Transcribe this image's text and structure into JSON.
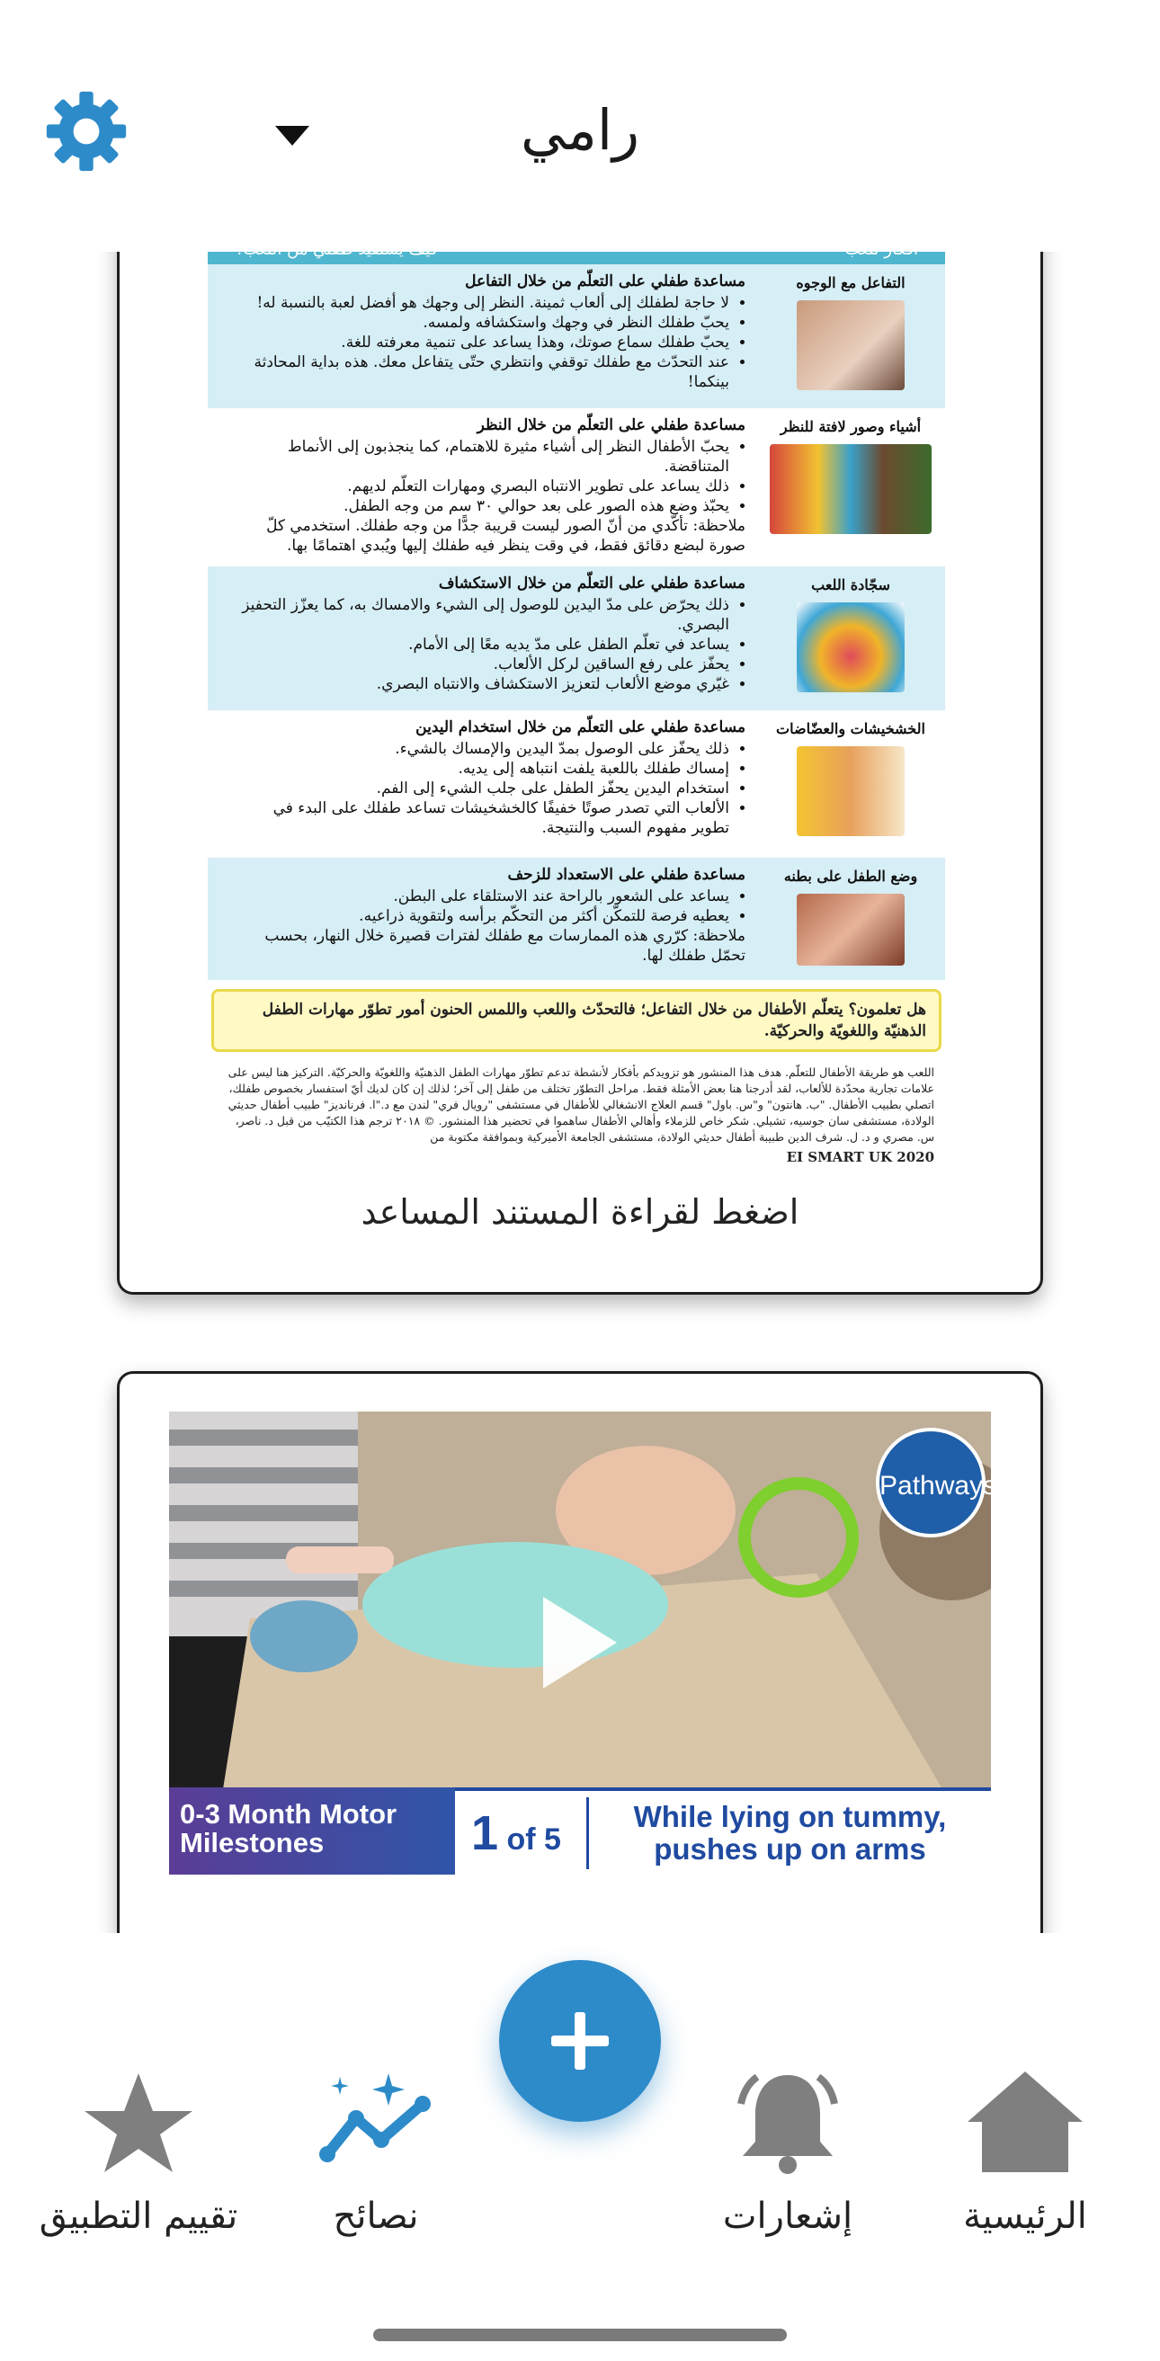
{
  "header": {
    "title": "رامي",
    "settings_icon": "gear-icon",
    "dropdown_icon": "caret-down-icon"
  },
  "doc_card": {
    "page": {
      "header_left": "كيف يستفيد طفلي من اللعب؟",
      "header_right": "أفكار للعب",
      "rows": [
        {
          "label": "التفاعل مع الوجوه",
          "title": "مساعدة طفلي على التعلّم من خلال التفاعل",
          "bullets": [
            "لا حاجة لطفلك إلى ألعاب ثمينة. النظر إلى وجهك هو أفضل لعبة بالنسبة له!",
            "يحبّ طفلك النظر في وجهك واستكشافه ولمسه.",
            "يحبّ طفلك سماع صوتك، وهذا يساعد على تنمية معرفته للغة.",
            "عند التحدّث مع طفلك توقفي وانتظري حتّى يتفاعل معك. هذه بداية المحادثة بينكما!"
          ]
        },
        {
          "label": "أشياء وصور لافتة للنظر",
          "title": "مساعدة طفلي على التعلّم من خلال النظر",
          "bullets": [
            "يحبّ الأطفال النظر إلى أشياء مثيرة للاهتمام، كما ينجذبون إلى الأنماط المتناقضة.",
            "ذلك يساعد على تطوير الانتباه البصري ومهارات التعلّم لديهم.",
            "يحبّذ وضع هذه الصور على بعد حوالي ٣٠ سم من وجه الطفل."
          ],
          "note": "ملاحظة: تأكّدي من أنّ الصور ليست قريبة جدًّا من وجه طفلك. استخدمي كلّ صورة لبضع دقائق فقط، في وقت ينظر فيه طفلك إليها ويُبدي اهتمامًا بها."
        },
        {
          "label": "سجّادة اللعب",
          "title": "مساعدة طفلي على التعلّم من خلال الاستكشاف",
          "bullets": [
            "ذلك يحرّض على مدّ اليدين للوصول إلى الشيء والامساك به، كما يعزّز التحفيز البصري.",
            "يساعد في تعلّم الطفل على مدّ يديه معًا إلى الأمام.",
            "يحفّز على رفع الساقين لركل الألعاب.",
            "غيّري موضع الألعاب لتعزيز الاستكشاف والانتباه البصري."
          ]
        },
        {
          "label": "الخشخيشات والعضّاضات",
          "title": "مساعدة طفلي على التعلّم من خلال استخدام اليدين",
          "bullets": [
            "ذلك يحفّز على الوصول بمدّ اليدين والإمساك بالشيء.",
            "إمساك طفلك باللعبة يلفت انتباهه إلى يديه.",
            "استخدام اليدين يحفّز الطفل على جلب الشيء إلى الفم.",
            "الألعاب التي تصدر صوتًا خفيفًا كالخشخيشات تساعد طفلك على البدء في تطوير مفهوم السبب والنتيجة."
          ]
        },
        {
          "label": "وضع الطفل على بطنه",
          "title": "مساعدة طفلي على الاستعداد للزحف",
          "bullets": [
            "يساعد على الشعور بالراحة عند الاستلقاء على البطن.",
            "يعطيه فرصة للتمكّن أكثر من التحكّم برأسه ولتقوية ذراعيه."
          ],
          "note": "ملاحظة: كرّري هذه الممارسات مع طفلك لفترات قصيرة خلال النهار، بحسب تحمّل طفلك لها."
        }
      ],
      "highlight": "هل تعلمون؟ يتعلّم الأطفال من خلال التفاعل؛ فالتحدّث واللعب واللمس الحنون أمور تطوّر مهارات الطفل الذهنيّة واللغويّة والحركيّة.",
      "footer": "اللعب هو طريقة الأطفال للتعلّم. هدف هذا المنشور هو تزويدكم بأفكار لأنشطة تدعم تطوّر مهارات الطفل الذهنيّة واللغويّة والحركيّة. التركيز هنا ليس على علامات تجارية محدّدة للألعاب، لقد أدرجنا هنا بعض الأمثلة فقط. مراحل التطوّر تختلف من طفل إلى آخر؛ لذلك إن كان لديك أيّ استفسار بخصوص طفلك، اتصلي بطبيب الأطفال. \"ب. هانتون\" و\"س. باول\" قسم العلاج الانشغالي للأطفال في مستشفى \"رويال فري\" لندن مع د.\"ا. فرنانديز\" طبيب أطفال حديثي الولادة، مستشفى سان جوسيه، تشيلي. شكر خاص للزملاء وأهالي الأطفال ساهموا في تحضير هذا المنشور. © ٢٠١٨ ترجم هذا الكتيّب من قبل د. ناصر، س. مصري و د. ل. شرف الدين طبيبة أطفال حديثي الولادة، مستشفى الجامعة الأميركية وبموافقة مكتوبة من",
      "signature": "EI SMART UK 2020"
    },
    "caption": "اضغط لقراءة المستند المساعد"
  },
  "video_card": {
    "badge": "Pathways",
    "banner_left": "0-3 Month Motor Milestones",
    "banner_count_num": "1",
    "banner_count_rest": "of 5",
    "banner_text": "While lying on tummy, pushes up on arms",
    "play_icon": "play-icon"
  },
  "fab": {
    "icon": "plus-icon"
  },
  "nav": [
    {
      "label": "الرئيسية",
      "icon": "home-icon"
    },
    {
      "label": "إشعارات",
      "icon": "bell-icon"
    },
    {
      "label": "نصائح",
      "icon": "trend-sparkle-icon"
    },
    {
      "label": "تقييم التطبيق",
      "icon": "star-icon"
    }
  ],
  "colors": {
    "accent": "#2e8bc9",
    "nav_icon": "#7f7f7f",
    "doc_header": "#4fb6cf",
    "doc_row_blue": "#d6eef5",
    "video_banner_text": "#1f4aa0"
  }
}
